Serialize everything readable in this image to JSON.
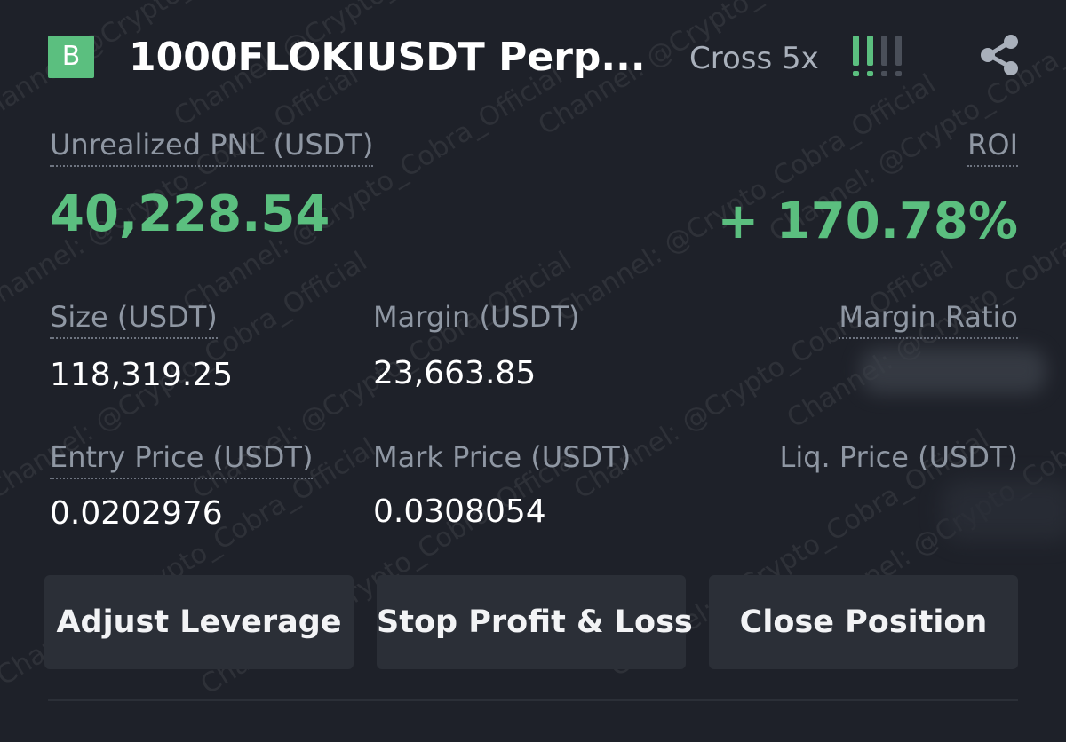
{
  "header": {
    "badge": "B",
    "symbol": "1000FLOKIUSDT Perp...",
    "margin_mode": "Cross 5x",
    "risk_icon": "risk-level-icon",
    "share_icon": "share-icon"
  },
  "pnl": {
    "label": "Unrealized PNL (USDT)",
    "value": "40,228.54",
    "roi_label": "ROI",
    "roi_value": "+ 170.78%"
  },
  "stats": {
    "size_label": "Size (USDT)",
    "size_value": "118,319.25",
    "margin_label": "Margin (USDT)",
    "margin_value": "23,663.85",
    "margin_ratio_label": "Margin Ratio",
    "entry_label": "Entry Price (USDT)",
    "entry_value": "0.0202976",
    "mark_label": "Mark Price (USDT)",
    "mark_value": "0.0308054",
    "liq_label": "Liq. Price (USDT)"
  },
  "actions": {
    "adjust_leverage": "Adjust Leverage",
    "stop_profit_loss": "Stop Profit & Loss",
    "close_position": "Close Position"
  },
  "watermark": "Channel: @Crypto_Cobra_Official",
  "colors": {
    "background": "#1e2129",
    "positive": "#5bbf7f",
    "label": "#8f97a3",
    "button": "#2b2f37"
  }
}
